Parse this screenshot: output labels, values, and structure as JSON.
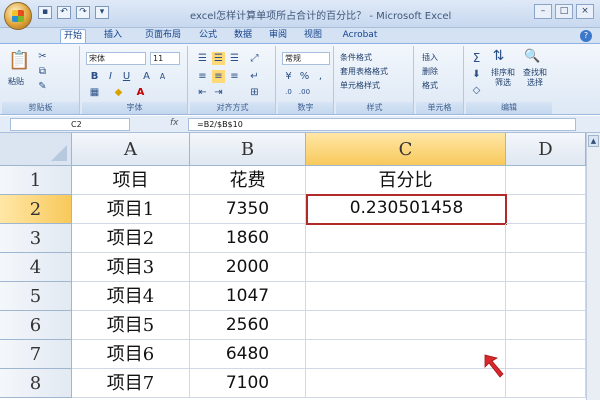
{
  "window": {
    "title": "excel怎样计算单项所占合计的百分比？ - Microsoft Excel",
    "controls": [
      "–",
      "□",
      "×"
    ]
  },
  "ribbon": {
    "tabs": [
      "开始",
      "插入",
      "页面布局",
      "公式",
      "数据",
      "审阅",
      "视图",
      "Acrobat"
    ],
    "active_tab": "开始",
    "font_name": "宋体",
    "font_size": "11",
    "number_format": "常规",
    "clipboard_paste": "粘贴",
    "styles": [
      "条件格式",
      "套用表格格式",
      "单元格样式"
    ],
    "cells": [
      "插入",
      "删除",
      "格式"
    ],
    "editing": [
      "排序和筛选",
      "查找和选择"
    ],
    "group_labels": [
      "剪贴板",
      "字体",
      "对齐方式",
      "数字",
      "样式",
      "单元格",
      "编辑"
    ]
  },
  "formula_bar": {
    "name_box": "C2",
    "fx": "fx",
    "formula": "=B2/$B$10"
  },
  "sheet": {
    "columns": [
      "A",
      "B",
      "C",
      "D"
    ],
    "selected_column": "C",
    "rows": [
      {
        "num": "1",
        "a": "项目",
        "b": "花费",
        "c": ""
      },
      {
        "num": "2",
        "a": "项目1",
        "b": "7350",
        "c": "0.230501458"
      },
      {
        "num": "3",
        "a": "项目2",
        "b": "1860",
        "c": ""
      },
      {
        "num": "4",
        "a": "项目3",
        "b": "2000",
        "c": ""
      },
      {
        "num": "5",
        "a": "项目4",
        "b": "1047",
        "c": ""
      },
      {
        "num": "6",
        "a": "项目5",
        "b": "2560",
        "c": ""
      },
      {
        "num": "7",
        "a": "项目6",
        "b": "6480",
        "c": ""
      },
      {
        "num": "8",
        "a": "项目7",
        "b": "7100",
        "c": ""
      }
    ],
    "header_c": "百分比",
    "active_cell": "C2"
  },
  "colors": {
    "active_cell_border": "#b12a2a",
    "selection_header": "#f8c95c",
    "ribbon_bg": "#dde8f5"
  }
}
